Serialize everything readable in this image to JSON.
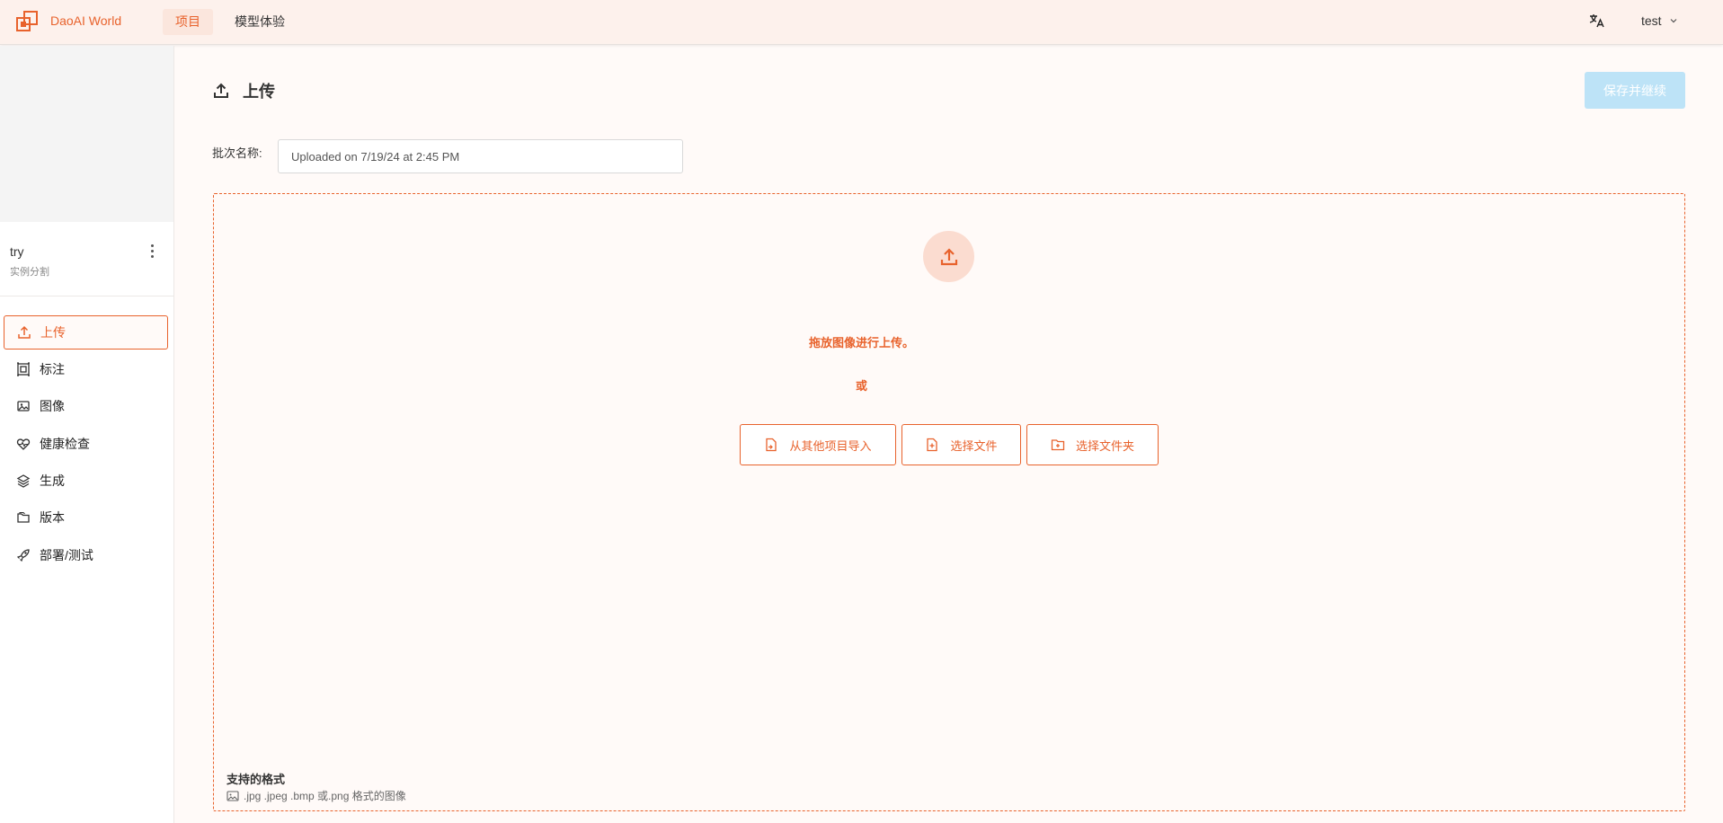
{
  "header": {
    "brand": "DaoAI World",
    "tabs": [
      {
        "label": "项目",
        "active": true
      },
      {
        "label": "模型体验",
        "active": false
      }
    ],
    "user": "test",
    "accent_color": "#e8622c"
  },
  "sidebar": {
    "project_name": "try",
    "project_type": "实例分割",
    "items": [
      {
        "label": "上传",
        "icon": "upload-icon",
        "active": true
      },
      {
        "label": "标注",
        "icon": "annotate-icon"
      },
      {
        "label": "图像",
        "icon": "image-icon"
      },
      {
        "label": "健康检查",
        "icon": "heart-icon"
      },
      {
        "label": "生成",
        "icon": "layers-icon"
      },
      {
        "label": "版本",
        "icon": "folders-icon"
      },
      {
        "label": "部署/测试",
        "icon": "rocket-icon"
      }
    ]
  },
  "main": {
    "title": "上传",
    "save_label": "保存并继续",
    "batch_label": "批次名称:",
    "batch_value": "Uploaded on 7/19/24 at 2:45 PM",
    "drop_text": "拖放图像进行上传。",
    "or_text": "或",
    "buttons": {
      "import": "从其他项目导入",
      "select_files": "选择文件",
      "select_folder": "选择文件夹"
    },
    "formats_title": "支持的格式",
    "formats_desc": ".jpg .jpeg .bmp 或.png 格式的图像"
  }
}
